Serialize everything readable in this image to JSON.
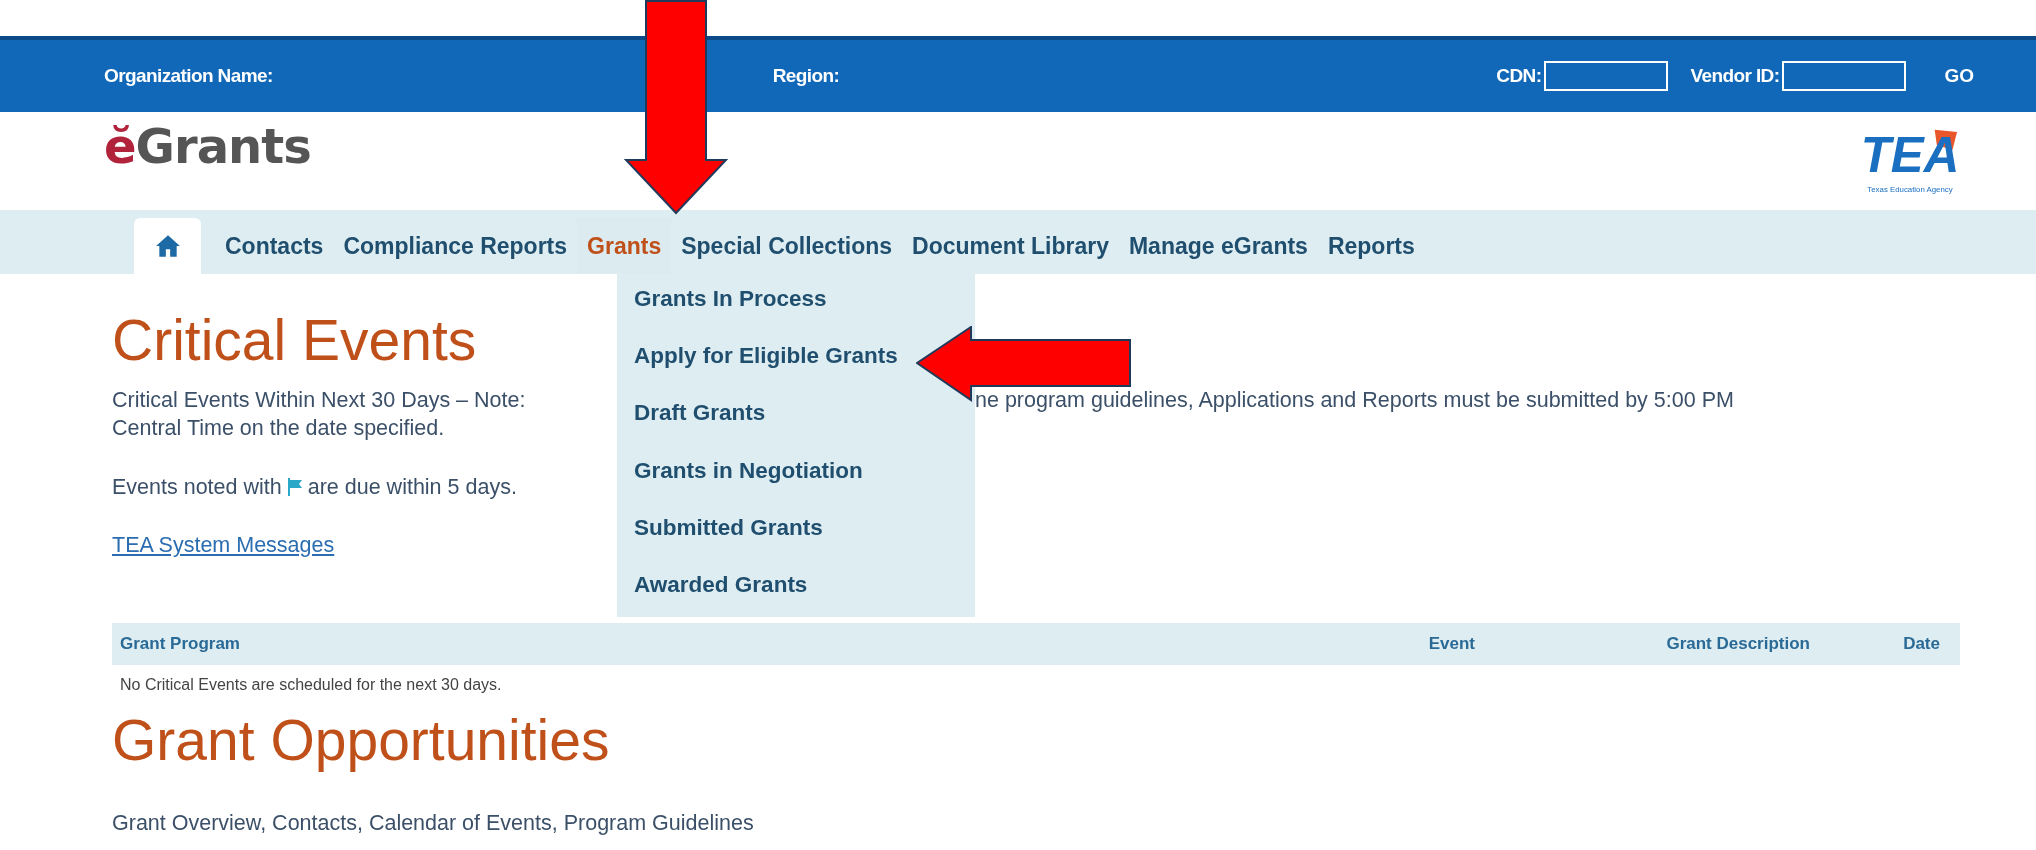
{
  "header_bar": {
    "organization_label": "Organization Name:",
    "region_label": "Region:",
    "cdn_label": "CDN:",
    "vendor_label": "Vendor ID:",
    "go": "GO"
  },
  "logo": {
    "prefix": "ĕ",
    "name": "Grants"
  },
  "agency_logo": {
    "letters": "TEA",
    "caption": "Texas Education Agency"
  },
  "nav": {
    "items": [
      {
        "kind": "home",
        "selected": false
      },
      {
        "label": "Contacts",
        "selected": false
      },
      {
        "label": "Compliance Reports",
        "selected": false
      },
      {
        "label": "Grants",
        "selected": true
      },
      {
        "label": "Special Collections",
        "selected": false
      },
      {
        "label": "Document Library",
        "selected": false
      },
      {
        "label": "Manage eGrants",
        "selected": false
      },
      {
        "label": "Reports",
        "selected": false
      }
    ],
    "dropdown": [
      "Grants In Process",
      "Apply for Eligible Grants",
      "Draft Grants",
      "Grants in Negotiation",
      "Submitted Grants",
      "Awarded Grants"
    ]
  },
  "critical_events": {
    "title": "Critical Events",
    "note_left": "Critical Events Within Next 30 Days – Note:",
    "note_right": "ne program guidelines, Applications and Reports must be submitted by 5:00 PM",
    "note_line2": "Central Time on the date specified.",
    "flag_before": "Events noted with",
    "flag_after": "are due within 5 days.",
    "link": "TEA System Messages",
    "table": {
      "columns": [
        "Grant Program",
        "Event",
        "Grant Description",
        "Date"
      ],
      "empty": "No Critical Events are scheduled for the next 30 days."
    }
  },
  "grant_opportunities": {
    "title": "Grant Opportunities",
    "text": "Grant Overview, Contacts, Calendar of Events, Program Guidelines"
  },
  "annotations": [
    {
      "kind": "arrow-down"
    },
    {
      "kind": "arrow-left"
    }
  ]
}
